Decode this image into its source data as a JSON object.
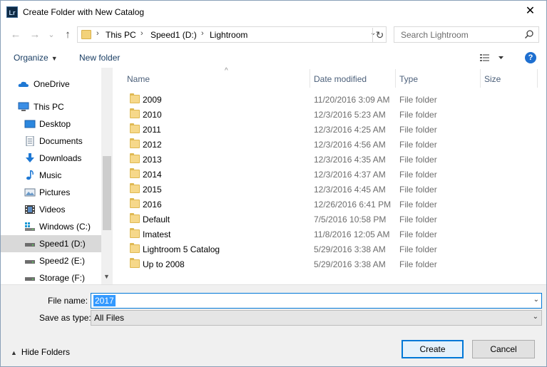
{
  "window": {
    "app_icon_text": "Lr",
    "title": "Create Folder with New Catalog",
    "close_glyph": "✕"
  },
  "navigation": {
    "back_glyph": "←",
    "forward_glyph": "→",
    "recent_glyph": "⌄",
    "up_glyph": "↑",
    "breadcrumbs": [
      "This PC",
      "Speed1 (D:)",
      "Lightroom"
    ],
    "breadcrumb_separator": "›",
    "refresh_glyph": "↻",
    "search_placeholder": "Search Lightroom"
  },
  "toolbar": {
    "organize_label": "Organize",
    "new_folder_label": "New folder",
    "help_label": "?"
  },
  "sidebar": {
    "items": [
      {
        "label": "OneDrive",
        "icon": "onedrive-icon",
        "selected": false
      },
      {
        "label": "This PC",
        "icon": "computer-icon",
        "selected": false
      },
      {
        "label": "Desktop",
        "icon": "desktop-icon",
        "selected": false
      },
      {
        "label": "Documents",
        "icon": "documents-icon",
        "selected": false
      },
      {
        "label": "Downloads",
        "icon": "downloads-icon",
        "selected": false
      },
      {
        "label": "Music",
        "icon": "music-icon",
        "selected": false
      },
      {
        "label": "Pictures",
        "icon": "pictures-icon",
        "selected": false
      },
      {
        "label": "Videos",
        "icon": "videos-icon",
        "selected": false
      },
      {
        "label": "Windows (C:)",
        "icon": "drive-icon",
        "selected": false
      },
      {
        "label": "Speed1 (D:)",
        "icon": "drive-icon",
        "selected": true
      },
      {
        "label": "Speed2 (E:)",
        "icon": "drive-icon",
        "selected": false
      },
      {
        "label": "Storage (F:)",
        "icon": "drive-icon",
        "selected": false
      }
    ]
  },
  "file_list": {
    "columns": [
      "Name",
      "Date modified",
      "Type",
      "Size"
    ],
    "rows": [
      {
        "name": "2009",
        "date": "11/20/2016 3:09 AM",
        "type": "File folder"
      },
      {
        "name": "2010",
        "date": "12/3/2016 5:23 AM",
        "type": "File folder"
      },
      {
        "name": "2011",
        "date": "12/3/2016 4:25 AM",
        "type": "File folder"
      },
      {
        "name": "2012",
        "date": "12/3/2016 4:56 AM",
        "type": "File folder"
      },
      {
        "name": "2013",
        "date": "12/3/2016 4:35 AM",
        "type": "File folder"
      },
      {
        "name": "2014",
        "date": "12/3/2016 4:37 AM",
        "type": "File folder"
      },
      {
        "name": "2015",
        "date": "12/3/2016 4:45 AM",
        "type": "File folder"
      },
      {
        "name": "2016",
        "date": "12/26/2016 6:41 PM",
        "type": "File folder"
      },
      {
        "name": "Default",
        "date": "7/5/2016 10:58 PM",
        "type": "File folder"
      },
      {
        "name": "Imatest",
        "date": "11/8/2016 12:05 AM",
        "type": "File folder"
      },
      {
        "name": "Lightroom 5 Catalog",
        "date": "5/29/2016 3:38 AM",
        "type": "File folder"
      },
      {
        "name": "Up to 2008",
        "date": "5/29/2016 3:38 AM",
        "type": "File folder"
      }
    ]
  },
  "form": {
    "file_name_label": "File name:",
    "file_name_value": "2017",
    "save_as_type_label": "Save as type:",
    "save_as_type_value": "All Files",
    "hide_folders_label": "Hide Folders",
    "create_label": "Create",
    "cancel_label": "Cancel"
  }
}
